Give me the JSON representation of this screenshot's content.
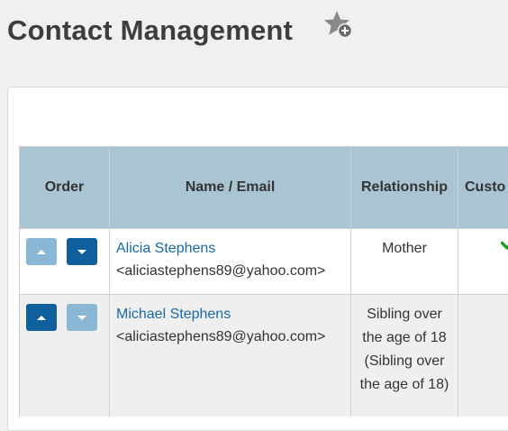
{
  "page": {
    "title": "Contact Management"
  },
  "table": {
    "headers": {
      "order": "Order",
      "name_email": "Name / Email",
      "relationship": "Relationship",
      "custody": "Custo"
    },
    "rows": [
      {
        "name": "Alicia Stephens",
        "email": "<aliciastephens89@yahoo.com>",
        "relationship": "Mother",
        "custody": true,
        "move_up_enabled": false,
        "move_down_enabled": true
      },
      {
        "name": "Michael Stephens",
        "email": "<aliciastephens89@yahoo.com>",
        "relationship": "Sibling over the age of 18 (Sibling over the age of 18)",
        "custody": false,
        "move_up_enabled": true,
        "move_down_enabled": false
      }
    ]
  },
  "icons": {
    "favorite": "star-plus-icon",
    "move_up": "caret-up-icon",
    "move_down": "caret-down-icon",
    "custody": "checkmark-icon"
  },
  "colors": {
    "header_bg": "#a9c4d2",
    "button_active": "#0e5f9c",
    "button_disabled": "#8ab7d5",
    "link": "#1b6aa5",
    "check": "#1aa31a"
  }
}
